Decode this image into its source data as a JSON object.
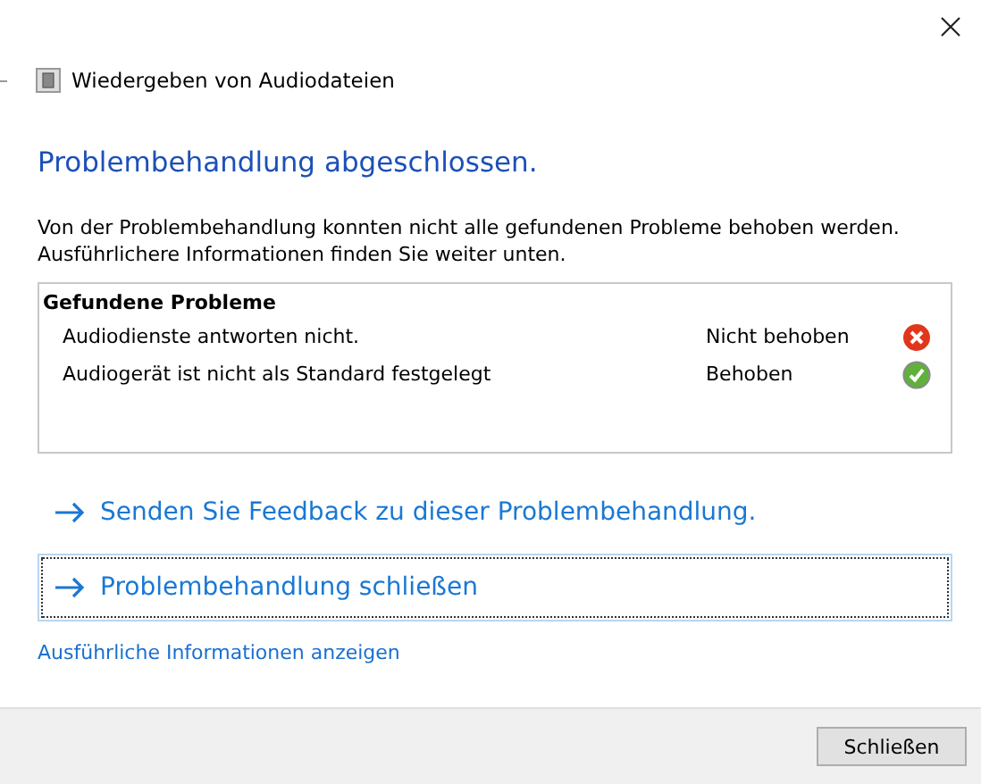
{
  "window": {
    "title": "Wiedergeben von Audiodateien"
  },
  "heading": "Problembehandlung abgeschlossen.",
  "description": [
    "Von der Problembehandlung konnten nicht alle gefundenen Probleme behoben werden.",
    "Ausführlichere Informationen finden Sie weiter unten."
  ],
  "problems": {
    "title": "Gefundene Probleme",
    "items": [
      {
        "name": "Audiodienste antworten nicht.",
        "status": "Nicht behoben",
        "fixed": false
      },
      {
        "name": "Audiogerät ist nicht als Standard festgelegt",
        "status": "Behoben",
        "fixed": true
      }
    ]
  },
  "command_links": [
    {
      "label": "Senden Sie Feedback zu dieser Problembehandlung.",
      "focused": false
    },
    {
      "label": "Problembehandlung schließen",
      "focused": true
    }
  ],
  "details_link": "Ausführliche Informationen anzeigen",
  "buttons": [
    "Schließen"
  ]
}
